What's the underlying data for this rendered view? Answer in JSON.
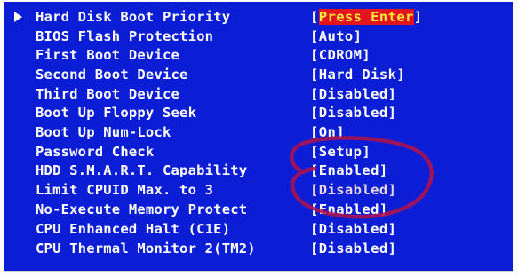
{
  "bios": {
    "items": [
      {
        "label": "Hard Disk Boot Priority",
        "bracket_open": "[",
        "value": "Press Enter",
        "bracket_close": "]",
        "selected": true,
        "highlight": true
      },
      {
        "label": "BIOS Flash Protection",
        "bracket_open": "[",
        "value": "Auto",
        "bracket_close": "]"
      },
      {
        "label": "First Boot Device",
        "bracket_open": "[",
        "value": "CDROM",
        "bracket_close": "]"
      },
      {
        "label": "Second Boot Device",
        "bracket_open": "[",
        "value": "Hard Disk",
        "bracket_close": "]"
      },
      {
        "label": "Third Boot Device",
        "bracket_open": "[",
        "value": "Disabled",
        "bracket_close": "]"
      },
      {
        "label": "Boot Up Floppy Seek",
        "bracket_open": "[",
        "value": "Disabled",
        "bracket_close": "]"
      },
      {
        "label": "Boot Up Num-Lock",
        "bracket_open": "[",
        "value": "On",
        "bracket_close": "]"
      },
      {
        "label": "Password Check",
        "bracket_open": "[",
        "value": "Setup",
        "bracket_close": "]"
      },
      {
        "label": "HDD S.M.A.R.T. Capability",
        "bracket_open": "[",
        "value": "Enabled",
        "bracket_close": "]"
      },
      {
        "label": "Limit CPUID Max. to 3",
        "bracket_open": "[",
        "value": "Disabled",
        "bracket_close": "]",
        "faded": true
      },
      {
        "label": "No-Execute Memory Protect",
        "bracket_open": "[",
        "value": "Enabled",
        "bracket_close": "]"
      },
      {
        "label": "CPU Enhanced Halt (C1E)",
        "bracket_open": "[",
        "value": "Disabled",
        "bracket_close": "]"
      },
      {
        "label": "CPU Thermal Monitor 2(TM2)",
        "bracket_open": "[",
        "value": "Disabled",
        "bracket_close": "]"
      }
    ],
    "selection_arrow": "triangle-right-icon",
    "annotation": "hand-drawn-circle-annotation"
  },
  "colors": {
    "background": "#0b1ed6",
    "text": "#ffffff",
    "highlight_bg": "#e4141e",
    "highlight_text": "#f6e93a",
    "annotation": "#b3124a"
  }
}
